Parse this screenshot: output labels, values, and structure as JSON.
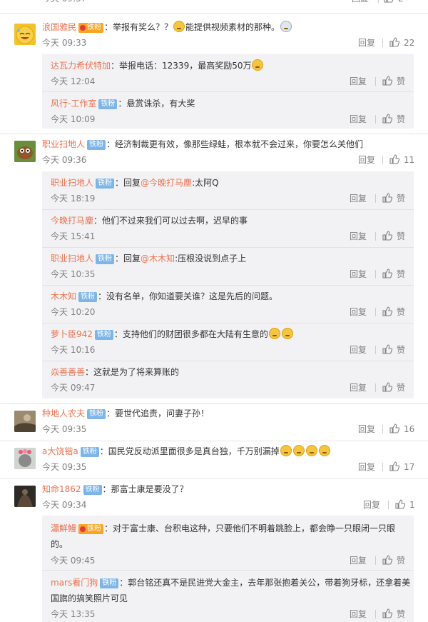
{
  "ui": {
    "reply_label": "回复",
    "like_label": "赞"
  },
  "top_cut": {
    "time": "今天 09:37",
    "likes": "2"
  },
  "comments": [
    {
      "user": "浪国雅民",
      "badge": "铁粉",
      "vip": true,
      "sep": "：",
      "text_a": "举报有奖么？？",
      "text_b": "能提供视频素材的那种。",
      "time": "今天 09:33",
      "likes": "22",
      "replies": [
        {
          "user": "达瓦力希伏特加",
          "sep": "：",
          "text": "举报电话：12339，最高奖励50万",
          "time": "今天 12:04"
        },
        {
          "user": "风行-工作室",
          "badge": "铁粉",
          "sep": "：",
          "text": "悬赏诛杀，有大奖",
          "time": "今天 10:09"
        }
      ]
    },
    {
      "user": "职业扫地人",
      "badge": "铁粉",
      "sep": "：",
      "text": "经济制裁更有效，像那些绿蛙，根本就不会过来，你要怎么关他们",
      "time": "今天 09:36",
      "likes": "11",
      "replies": [
        {
          "user": "职业扫地人",
          "badge": "铁粉",
          "sep": "：",
          "prefix": "回复",
          "mention": "@今晚打马塵",
          "text": ":太阿Q",
          "time": "今天 18:19"
        },
        {
          "user": "今晚打马塵",
          "sep": "：",
          "text": "他们不过来我们可以过去啊，迟早的事",
          "time": "今天 15:41"
        },
        {
          "user": "职业扫地人",
          "badge": "铁粉",
          "sep": "：",
          "prefix": "回复",
          "mention": "@木木知",
          "text": ":压根没说到点子上",
          "time": "今天 10:35"
        },
        {
          "user": "木木知",
          "badge": "铁粉",
          "sep": "：",
          "text": "没有名单，你知道要关谁？这是先后的问题。",
          "time": "今天 10:20"
        },
        {
          "user": "萝卜臣942",
          "badge": "铁粉",
          "sep": "：",
          "text": "支持他们的财团很多都在大陆有生意的",
          "time": "今天 10:16"
        },
        {
          "user": "焱善善善",
          "sep": "：",
          "text": "这就是为了将来算账的",
          "time": "今天 09:47"
        }
      ]
    },
    {
      "user": "种地人农夫",
      "badge": "铁粉",
      "sep": "：",
      "text": "要世代追责，问妻子孙！",
      "time": "今天 09:35",
      "likes": "16"
    },
    {
      "user": "a大饶锴a",
      "badge": "铁粉",
      "sep": "：",
      "text": "国民党反动派里面很多是真台独，千万别漏掉",
      "time": "今天 09:35",
      "likes": "17"
    },
    {
      "user": "知命1862",
      "badge": "铁粉",
      "sep": "：",
      "text": "那富士康是要没了？",
      "time": "今天 09:34",
      "likes": "1",
      "replies": [
        {
          "user": "瀟鮮鰻",
          "badge": "铁粉",
          "vip": true,
          "sep": "：",
          "text": "对于富士康、台积电这种，只要他们不明着跳脸上，都会睁一只眼闭一只眼的。",
          "time": "今天 09:45"
        },
        {
          "user": "mars看门狗",
          "badge": "铁粉",
          "sep": "：",
          "text": "郭台铭还真不是民进党大金主，去年那张抱着关公，带着狗牙标，还拿着美国旗的搞笑照片可见",
          "time": "今天 13:35"
        }
      ]
    }
  ],
  "colors": {
    "name": "#eb7350",
    "badge": "#7eb5e8",
    "reply_bg": "#f2f2f5",
    "meta": "#808080"
  }
}
